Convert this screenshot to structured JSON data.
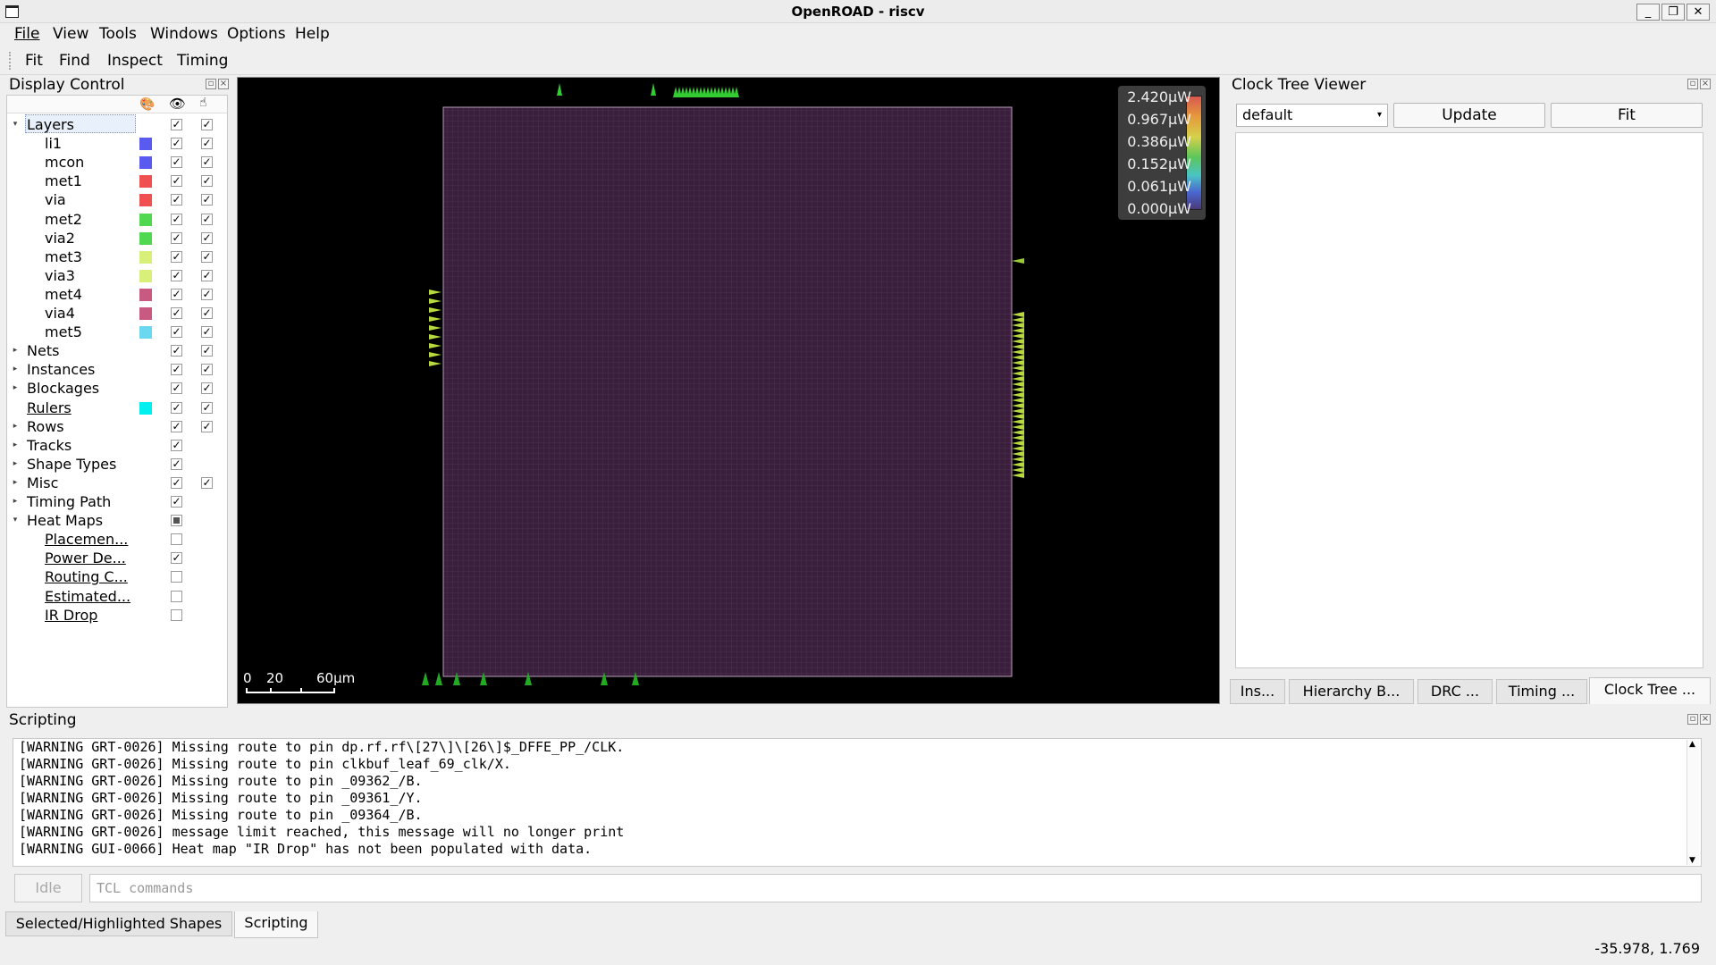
{
  "window": {
    "title": "OpenROAD - riscv",
    "buttons": [
      "_",
      "❐",
      "✕"
    ]
  },
  "menubar": [
    "File",
    "View",
    "Tools",
    "Windows",
    "Options",
    "Help"
  ],
  "toolbar": [
    "Fit",
    "Find",
    "Inspect",
    "Timing"
  ],
  "display_control": {
    "title": "Display Control",
    "header_icons": [
      "palette-icon",
      "eye-icon",
      "pointer-icon"
    ],
    "rows": [
      {
        "label": "Layers",
        "expanded": true,
        "visible": true,
        "selectable": true
      },
      {
        "label": "li1",
        "color": "#5a5af0",
        "visible": true,
        "selectable": true
      },
      {
        "label": "mcon",
        "color": "#5a5af0",
        "visible": true,
        "selectable": true
      },
      {
        "label": "met1",
        "color": "#f05050",
        "visible": true,
        "selectable": true
      },
      {
        "label": "via",
        "color": "#f05050",
        "visible": true,
        "selectable": true
      },
      {
        "label": "met2",
        "color": "#50d850",
        "visible": true,
        "selectable": true
      },
      {
        "label": "via2",
        "color": "#50d850",
        "visible": true,
        "selectable": true
      },
      {
        "label": "met3",
        "color": "#d8f07a",
        "visible": true,
        "selectable": true
      },
      {
        "label": "via3",
        "color": "#d8f07a",
        "visible": true,
        "selectable": true
      },
      {
        "label": "met4",
        "color": "#c85a82",
        "visible": true,
        "selectable": true
      },
      {
        "label": "via4",
        "color": "#c85a82",
        "visible": true,
        "selectable": true
      },
      {
        "label": "met5",
        "color": "#6ad8f0",
        "visible": true,
        "selectable": true
      },
      {
        "label": "Nets",
        "visible": true,
        "selectable": true
      },
      {
        "label": "Instances",
        "visible": true,
        "selectable": true
      },
      {
        "label": "Blockages",
        "visible": true,
        "selectable": true
      },
      {
        "label": "Rulers",
        "color": "#00f0f0",
        "visible": true,
        "selectable": true
      },
      {
        "label": "Rows",
        "visible": true,
        "selectable": true
      },
      {
        "label": "Tracks",
        "visible": true
      },
      {
        "label": "Shape Types",
        "visible": true
      },
      {
        "label": "Misc",
        "visible": true,
        "selectable": true
      },
      {
        "label": "Timing Path",
        "visible": true
      },
      {
        "label": "Heat Maps",
        "expanded": true,
        "visible": "partial"
      },
      {
        "label": "Placemen...",
        "visible": false
      },
      {
        "label": "Power De...",
        "visible": true
      },
      {
        "label": "Routing C...",
        "visible": false
      },
      {
        "label": "Estimated...",
        "visible": false
      },
      {
        "label": "IR Drop",
        "visible": false
      }
    ]
  },
  "viewer": {
    "scale_labels": [
      "0",
      "20",
      "60µm"
    ],
    "legend_values": [
      "2.420µW",
      "0.967µW",
      "0.386µW",
      "0.152µW",
      "0.061µW",
      "0.000µW"
    ]
  },
  "clock_tree_viewer": {
    "title": "Clock Tree Viewer",
    "corner": "default",
    "update_label": "Update",
    "fit_label": "Fit",
    "tabs": [
      "Ins...",
      "Hierarchy B...",
      "DRC ...",
      "Timing ...",
      "Clock Tree ..."
    ]
  },
  "scripting": {
    "title": "Scripting",
    "log": [
      "[WARNING GRT-0026] Missing route to pin dp.rf.rf\\[27\\]\\[26\\]$_DFFE_PP_/CLK.",
      "[WARNING GRT-0026] Missing route to pin clkbuf_leaf_69_clk/X.",
      "[WARNING GRT-0026] Missing route to pin _09362_/B.",
      "[WARNING GRT-0026] Missing route to pin _09361_/Y.",
      "[WARNING GRT-0026] Missing route to pin _09364_/B.",
      "[WARNING GRT-0026] message limit reached, this message will no longer print",
      "[WARNING GUI-0066] Heat map \"IR Drop\" has not been populated with data."
    ],
    "idle_label": "Idle",
    "input_placeholder": "TCL commands"
  },
  "bottom_tabs": [
    "Selected/Highlighted Shapes",
    "Scripting"
  ],
  "status": {
    "coords": "-35.978, 1.769"
  }
}
